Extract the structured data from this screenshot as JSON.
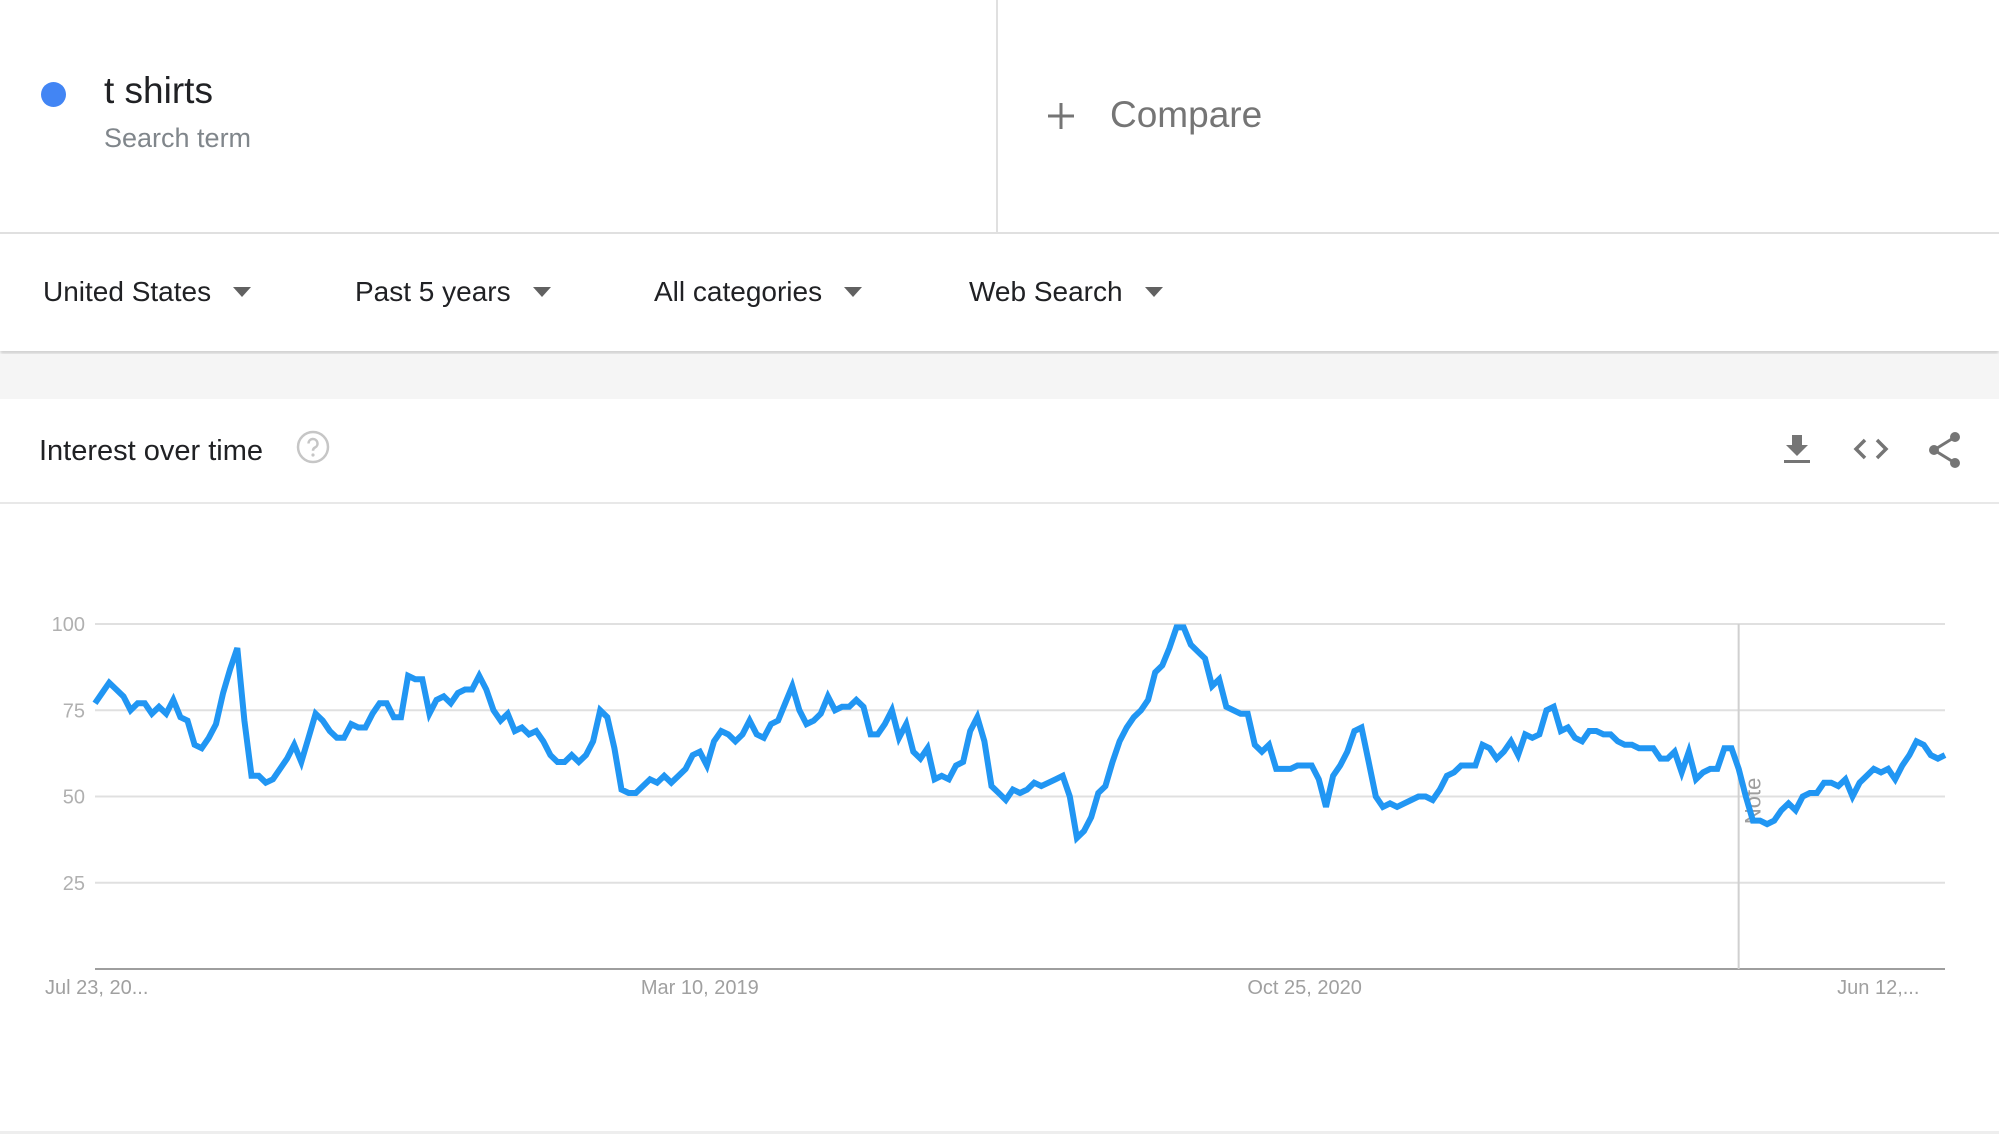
{
  "search_term": {
    "name": "t shirts",
    "subtitle": "Search term",
    "color": "#4285f4"
  },
  "compare": {
    "icon": "plus-icon",
    "label": "Compare"
  },
  "filters": [
    {
      "label": "United States",
      "icon": "caret-down-icon"
    },
    {
      "label": "Past 5 years",
      "icon": "caret-down-icon"
    },
    {
      "label": "All categories",
      "icon": "caret-down-icon"
    },
    {
      "label": "Web Search",
      "icon": "caret-down-icon"
    }
  ],
  "card": {
    "title": "Interest over time",
    "help_icon": "help-circle-icon",
    "actions": [
      {
        "name": "download",
        "icon": "download-icon"
      },
      {
        "name": "embed",
        "icon": "code-icon"
      },
      {
        "name": "share",
        "icon": "share-icon"
      }
    ]
  },
  "chart_data": {
    "type": "line",
    "title": "Interest over time",
    "xlabel": "",
    "ylabel": "",
    "ylim": [
      0,
      100
    ],
    "yticks": [
      25,
      50,
      75,
      100
    ],
    "ytick_labels": [
      "25",
      "50",
      "75",
      "100"
    ],
    "xtick_labels": [
      "Jul 23, 20...",
      "Mar 10, 2019",
      "Oct 25, 2020",
      "Jun 12,..."
    ],
    "xtick_positions": [
      0,
      85,
      170,
      255
    ],
    "grid": true,
    "line_color": "#2196f3",
    "annotation": {
      "label": "Note",
      "index": 231
    },
    "series": [
      {
        "name": "t shirts",
        "values": [
          77,
          80,
          83,
          81,
          79,
          75,
          77,
          77,
          74,
          76,
          74,
          78,
          73,
          72,
          65,
          64,
          67,
          71,
          80,
          87,
          93,
          72,
          56,
          56,
          54,
          55,
          58,
          61,
          65,
          60,
          67,
          74,
          72,
          69,
          67,
          67,
          71,
          70,
          70,
          74,
          77,
          77,
          73,
          73,
          85,
          84,
          84,
          74,
          78,
          79,
          77,
          80,
          81,
          81,
          85,
          81,
          75,
          72,
          74,
          69,
          70,
          68,
          69,
          66,
          62,
          60,
          60,
          62,
          60,
          62,
          66,
          75,
          73,
          64,
          52,
          51,
          51,
          53,
          55,
          54,
          56,
          54,
          56,
          58,
          62,
          63,
          59,
          66,
          69,
          68,
          66,
          68,
          72,
          68,
          67,
          71,
          72,
          77,
          82,
          75,
          71,
          72,
          74,
          79,
          75,
          76,
          76,
          78,
          76,
          68,
          68,
          71,
          75,
          67,
          71,
          63,
          61,
          64,
          55,
          56,
          55,
          59,
          60,
          69,
          73,
          66,
          53,
          51,
          49,
          52,
          51,
          52,
          54,
          53,
          54,
          55,
          56,
          50,
          38,
          40,
          44,
          51,
          53,
          60,
          66,
          70,
          73,
          75,
          78,
          86,
          88,
          93,
          99,
          99,
          94,
          92,
          90,
          82,
          84,
          76,
          75,
          74,
          74,
          65,
          63,
          65,
          58,
          58,
          58,
          59,
          59,
          59,
          55,
          47,
          56,
          59,
          63,
          69,
          70,
          60,
          50,
          47,
          48,
          47,
          48,
          49,
          50,
          50,
          49,
          52,
          56,
          57,
          59,
          59,
          59,
          65,
          64,
          61,
          63,
          66,
          62,
          68,
          67,
          68,
          75,
          76,
          69,
          70,
          67,
          66,
          69,
          69,
          68,
          68,
          66,
          65,
          65,
          64,
          64,
          64,
          61,
          61,
          63,
          57,
          63,
          55,
          57,
          58,
          58,
          64,
          64,
          58,
          50,
          43,
          43,
          42,
          43,
          46,
          48,
          46,
          50,
          51,
          51,
          54,
          54,
          53,
          55,
          50,
          54,
          56,
          58,
          57,
          58,
          55,
          59,
          62,
          66,
          65,
          62,
          61,
          62
        ]
      }
    ]
  }
}
